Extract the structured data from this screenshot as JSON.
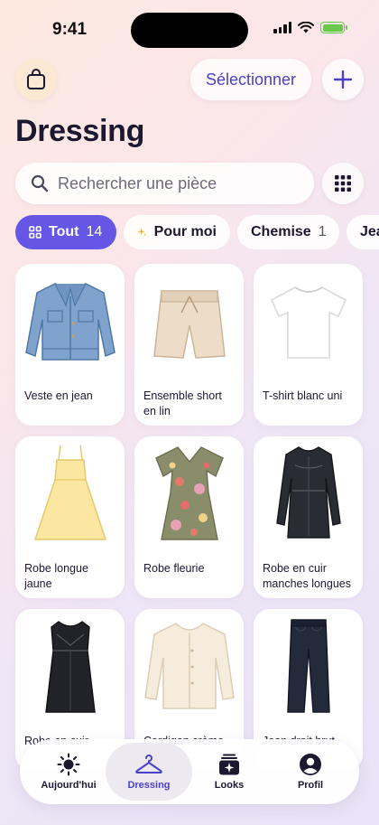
{
  "status_bar": {
    "time": "9:41"
  },
  "header": {
    "select_label": "Sélectionner",
    "title": "Dressing"
  },
  "search": {
    "placeholder": "Rechercher une pièce"
  },
  "filters": [
    {
      "label": "Tout",
      "count": "14",
      "active": true
    },
    {
      "label": "Pour moi",
      "count": "",
      "active": false
    },
    {
      "label": "Chemise",
      "count": "1",
      "active": false
    },
    {
      "label": "Jea",
      "count": "",
      "active": false
    }
  ],
  "items": [
    {
      "name": "Veste en jean",
      "icon": "denim-jacket"
    },
    {
      "name": "Ensemble short en lin",
      "icon": "linen-shorts"
    },
    {
      "name": "T-shirt blanc uni",
      "icon": "white-tshirt"
    },
    {
      "name": "Robe longue jaune",
      "icon": "yellow-dress"
    },
    {
      "name": "Robe fleurie",
      "icon": "floral-dress"
    },
    {
      "name": "Robe en cuir manches longues",
      "icon": "leather-long-sleeve-dress"
    },
    {
      "name": "Robe en cuir",
      "icon": "leather-dress"
    },
    {
      "name": "Cardigan crème",
      "icon": "cream-cardigan"
    },
    {
      "name": "Jean droit brut",
      "icon": "raw-jeans"
    }
  ],
  "tabbar": [
    {
      "label": "Aujourd'hui",
      "icon": "sun-icon",
      "active": false
    },
    {
      "label": "Dressing",
      "icon": "hanger-icon",
      "active": true
    },
    {
      "label": "Looks",
      "icon": "looks-icon",
      "active": false
    },
    {
      "label": "Profil",
      "icon": "profile-icon",
      "active": false
    }
  ],
  "colors": {
    "accent": "#6556e6",
    "accent_text": "#4b40c9",
    "bag_bg": "#fde8d4"
  }
}
